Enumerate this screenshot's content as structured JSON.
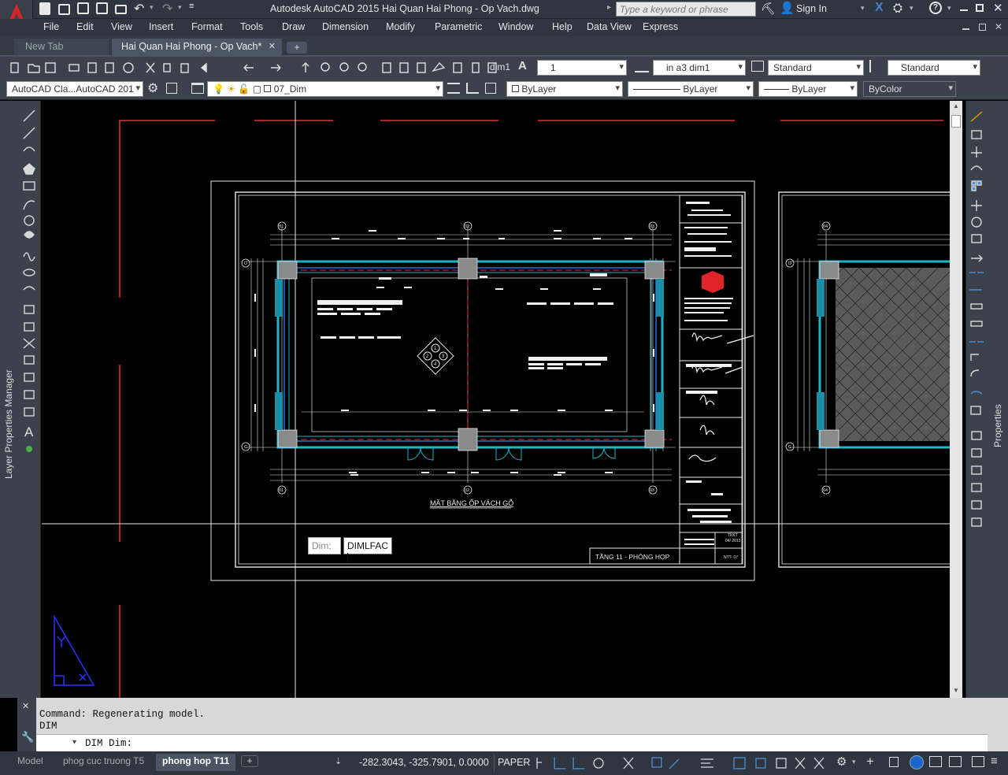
{
  "titlebar": {
    "app_title": "Autodesk AutoCAD 2015",
    "doc_title": "Hai Quan Hai Phong  - Op Vach.dwg",
    "search_placeholder": "Type a keyword or phrase",
    "sign_in": "Sign In"
  },
  "menubar": {
    "items": [
      "File",
      "Edit",
      "View",
      "Insert",
      "Format",
      "Tools",
      "Draw",
      "Dimension",
      "Modify",
      "Parametric",
      "Window",
      "Help",
      "Data View",
      "Express"
    ]
  },
  "tabs": {
    "new_tab": "New Tab",
    "active_tab": "Hai Quan Hai Phong  - Op Vach*",
    "add": "+"
  },
  "toolbar1": {
    "layer_value": "1",
    "dimstyle_value": "in a3 dim1",
    "textstyle_value": "Standard",
    "tablestyle_value": "Standard"
  },
  "toolbar2": {
    "workspace": "AutoCAD Cla...AutoCAD 201",
    "layer": "07_Dim",
    "color": "ByLayer",
    "linetype": "ByLayer",
    "lineweight": "ByLayer",
    "plotstyle": "ByColor"
  },
  "side_panels": {
    "left": "Layer Properties Manager",
    "right": "Properties"
  },
  "drawing": {
    "plan_title": "MẶT BẰNG ỐP VÁCH GỖ",
    "floor_label": "TẦNG 11 - PHÒNG HỌP",
    "grid_top": [
      "01",
      "02",
      "03"
    ],
    "grid_bottom": [
      "01",
      "02",
      "03"
    ],
    "grid_left": [
      "D",
      "C"
    ],
    "grid_right_top": [
      "04"
    ],
    "grid_right_bottom": [
      "04"
    ],
    "grid_far_left": [
      "D",
      "C"
    ],
    "compass": [
      "1",
      "2",
      "3",
      "4"
    ],
    "sheet_no": "NTT- 07",
    "date": "04/ 2013",
    "design": "TKKT"
  },
  "dim_input": {
    "label": "Dim:",
    "value": "DIMLFAC"
  },
  "command": {
    "line1": "Command: Regenerating model.",
    "line2": "DIM",
    "prompt": "DIM Dim:"
  },
  "status": {
    "layout_tabs": [
      "Model",
      "phog cuc truong T5",
      "phong hop T11"
    ],
    "active_layout": "phong hop T11",
    "coords": "-282.3043, -325.7901, 0.0000",
    "space": "PAPER"
  },
  "colors": {
    "canvas": "#000000",
    "wall": "#1fb5c8",
    "grid": "#e53030",
    "hatch": "#888888",
    "ucs": "#2a33ff"
  }
}
